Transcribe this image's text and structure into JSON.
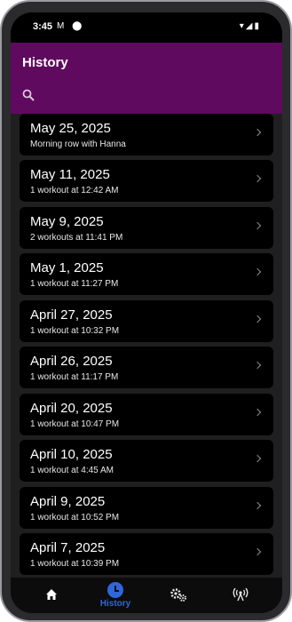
{
  "status_bar": {
    "time": "3:45",
    "left_icons": "M ⬤",
    "right_icons": "▾◢▮"
  },
  "app_bar": {
    "title": "History",
    "search_icon": "search-icon"
  },
  "history_items": [
    {
      "date": "May 25, 2025",
      "subtitle": "Morning row with Hanna"
    },
    {
      "date": "May 11, 2025",
      "subtitle": "1 workout at 12:42 AM"
    },
    {
      "date": "May 9, 2025",
      "subtitle": "2 workouts at 11:41 PM"
    },
    {
      "date": "May 1, 2025",
      "subtitle": "1 workout at 11:27 PM"
    },
    {
      "date": "April 27, 2025",
      "subtitle": "1 workout at 10:32 PM"
    },
    {
      "date": "April 26, 2025",
      "subtitle": "1 workout at 11:17 PM"
    },
    {
      "date": "April 20, 2025",
      "subtitle": "1 workout at 10:47 PM"
    },
    {
      "date": "April 10, 2025",
      "subtitle": "1 workout at 4:45 AM"
    },
    {
      "date": "April 9, 2025",
      "subtitle": "1 workout at 10:52 PM"
    },
    {
      "date": "April 7, 2025",
      "subtitle": "1 workout at 10:39 PM"
    }
  ],
  "bottom_nav": {
    "items": [
      {
        "name": "home",
        "icon": "home-icon",
        "label": ""
      },
      {
        "name": "history",
        "icon": "history-icon",
        "label": "History",
        "active": true
      },
      {
        "name": "settings",
        "icon": "gears-icon",
        "label": ""
      },
      {
        "name": "connect",
        "icon": "broadcast-icon",
        "label": ""
      }
    ]
  },
  "colors": {
    "app_bar": "#5f0a5f",
    "accent": "#2f67d8",
    "list_bg": "#1f1f1f",
    "card_bg": "#000000"
  }
}
